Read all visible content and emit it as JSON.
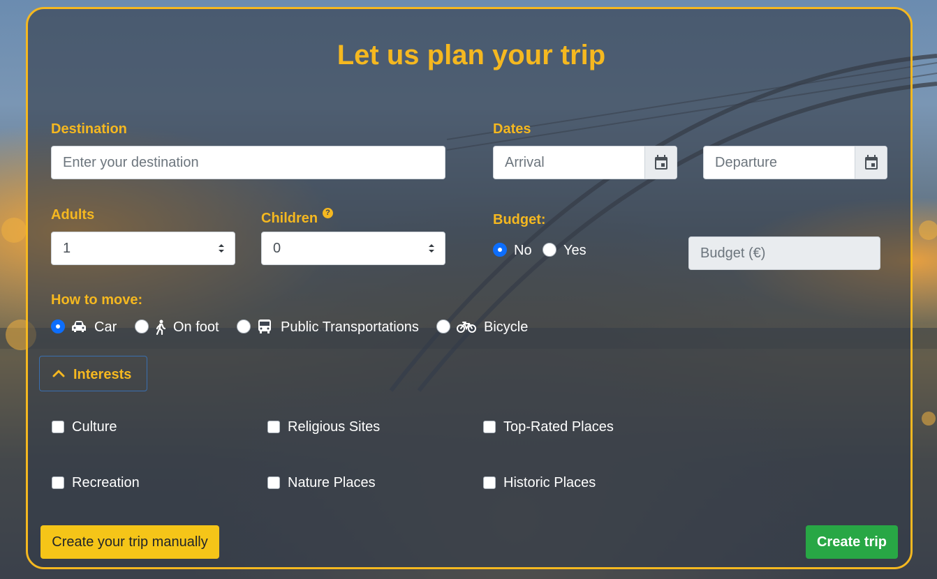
{
  "colors": {
    "accent": "#f5b820",
    "primary": "#0d6efd",
    "success": "#28a745"
  },
  "title": "Let us plan your trip",
  "destination": {
    "label": "Destination",
    "placeholder": "Enter your destination"
  },
  "dates": {
    "label": "Dates",
    "arrival_placeholder": "Arrival",
    "departure_placeholder": "Departure",
    "icon": "calendar-icon"
  },
  "adults": {
    "label": "Adults",
    "value": "1"
  },
  "children": {
    "label": "Children",
    "value": "0",
    "help_icon": "?"
  },
  "budget": {
    "label": "Budget:",
    "options": [
      "No",
      "Yes"
    ],
    "selected": "No",
    "placeholder": "Budget (€)"
  },
  "transport": {
    "label": "How to move:",
    "options": [
      {
        "label": "Car",
        "icon": "car-icon",
        "selected": true
      },
      {
        "label": "On foot",
        "icon": "walking-icon",
        "selected": false
      },
      {
        "label": "Public Transportations",
        "icon": "bus-icon",
        "selected": false
      },
      {
        "label": "Bicycle",
        "icon": "bicycle-icon",
        "selected": false
      }
    ]
  },
  "interests": {
    "label": "Interests",
    "items": [
      "Culture",
      "Religious Sites",
      "Top-Rated Places",
      "Recreation",
      "Nature Places",
      "Historic Places"
    ]
  },
  "buttons": {
    "manual": "Create your trip manually",
    "create": "Create trip"
  }
}
